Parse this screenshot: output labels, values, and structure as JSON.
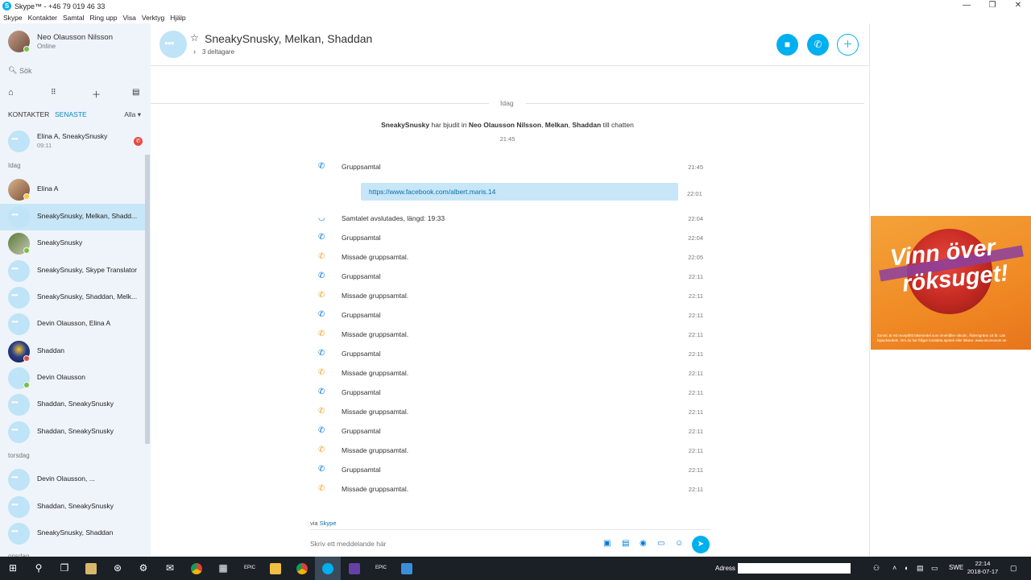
{
  "window": {
    "title": "Skype™ - +46 79 019 46 33",
    "minimize": "—",
    "maximize": "❐",
    "close": "✕"
  },
  "menu": [
    "Skype",
    "Kontakter",
    "Samtal",
    "Ring upp",
    "Visa",
    "Verktyg",
    "Hjälp"
  ],
  "profile": {
    "name": "Neo Olausson Nilsson",
    "status": "Online"
  },
  "search": {
    "placeholder": "Sök"
  },
  "tabs": {
    "contacts": "KONTAKTER",
    "recent": "SENASTE",
    "filter": "Alla ▾"
  },
  "sections": {
    "today": "Idag",
    "thursday": "torsdag",
    "partial": "onsdag"
  },
  "pinned": {
    "name": "Elina A, SneakySnusky",
    "time": "09:11"
  },
  "contacts": [
    "Elina A",
    "SneakySnusky, Melkan, Shadd...",
    "SneakySnusky",
    "SneakySnusky, Skype Translator",
    "SneakySnusky, Shaddan, Melk...",
    "Devin Olausson, Elina A",
    "Shaddan",
    "Devin Olausson",
    "Shaddan, SneakySnusky",
    "Shaddan, SneakySnusky"
  ],
  "contacts_thursday": [
    "Devin Olausson, ...",
    "Shaddan, SneakySnusky",
    "SneakySnusky, Shaddan"
  ],
  "chat": {
    "title": "SneakySnusky, Melkan, Shaddan",
    "participants": "3 deltagare",
    "day": "Idag",
    "invite_actor": "SneakySnusky",
    "invite_mid": " har bjudit in ",
    "invite_targets": "Neo Olausson Nilsson",
    "invite_sep1": ", ",
    "invite_t2": "Melkan",
    "invite_sep2": ", ",
    "invite_t3": "Shaddan",
    "invite_end": " till chatten",
    "invite_time": "21:45",
    "link": "https://www.facebook.com/albert.maris.14",
    "link_time": "22:01",
    "via_prefix": "via ",
    "via_link": "Skype",
    "composer_placeholder": "Skriv ett meddelande här"
  },
  "messages": [
    {
      "text": "Gruppsamtal",
      "time": "21:45",
      "type": "call"
    },
    {
      "text": "Samtalet avslutades, längd: 19:33",
      "time": "22:04",
      "type": "end"
    },
    {
      "text": "Gruppsamtal",
      "time": "22:04",
      "type": "call"
    },
    {
      "text": "Missade gruppsamtal.",
      "time": "22:05",
      "type": "missed"
    },
    {
      "text": "Gruppsamtal",
      "time": "22:11",
      "type": "call"
    },
    {
      "text": "Missade gruppsamtal.",
      "time": "22:11",
      "type": "missed"
    },
    {
      "text": "Gruppsamtal",
      "time": "22:11",
      "type": "call"
    },
    {
      "text": "Missade gruppsamtal.",
      "time": "22:11",
      "type": "missed"
    },
    {
      "text": "Gruppsamtal",
      "time": "22:11",
      "type": "call"
    },
    {
      "text": "Missade gruppsamtal.",
      "time": "22:11",
      "type": "missed"
    },
    {
      "text": "Gruppsamtal",
      "time": "22:11",
      "type": "call"
    },
    {
      "text": "Missade gruppsamtal.",
      "time": "22:11",
      "type": "missed"
    },
    {
      "text": "Gruppsamtal",
      "time": "22:11",
      "type": "call"
    },
    {
      "text": "Missade gruppsamtal.",
      "time": "22:11",
      "type": "missed"
    },
    {
      "text": "Gruppsamtal",
      "time": "22:11",
      "type": "call"
    },
    {
      "text": "Missade gruppsamtal.",
      "time": "22:11",
      "type": "missed"
    }
  ],
  "ad": {
    "line1": "Vinn över",
    "line2": "röksuget!",
    "fine_print": "Zonnic är ett receptfritt läkemedel som innehåller nikotin. Åldersgräns 18 år. Läs bipacksedeln. Om du har frågor kontakta apotek eller läkare. www.niconovum.se"
  },
  "taskbar": {
    "address_label": "Adress",
    "lang": "SWE",
    "time": "22:14",
    "date": "2018-07-17",
    "epic1": "EPIC",
    "epic2": "EPIC"
  },
  "colors": {
    "accent": "#00aff0",
    "sidebar": "#eef4fa",
    "selected": "#c7e6f8",
    "link_bubble": "#c7e6f8",
    "missed": "#f0a030",
    "call": "#0078d4"
  }
}
